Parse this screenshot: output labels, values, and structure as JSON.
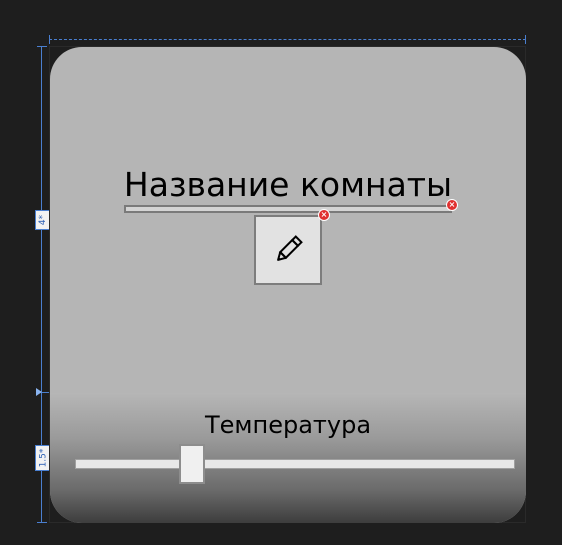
{
  "room": {
    "title": "Название комнаты",
    "name_value": ""
  },
  "edit_button": {
    "icon": "pencil-icon"
  },
  "validation": {
    "error_glyph": "×",
    "error_color": "#e03131"
  },
  "temperature": {
    "label": "Температура",
    "slider_value_fraction": 0.25
  },
  "designer": {
    "row1_size": "4*",
    "row2_size": "1.5*"
  }
}
